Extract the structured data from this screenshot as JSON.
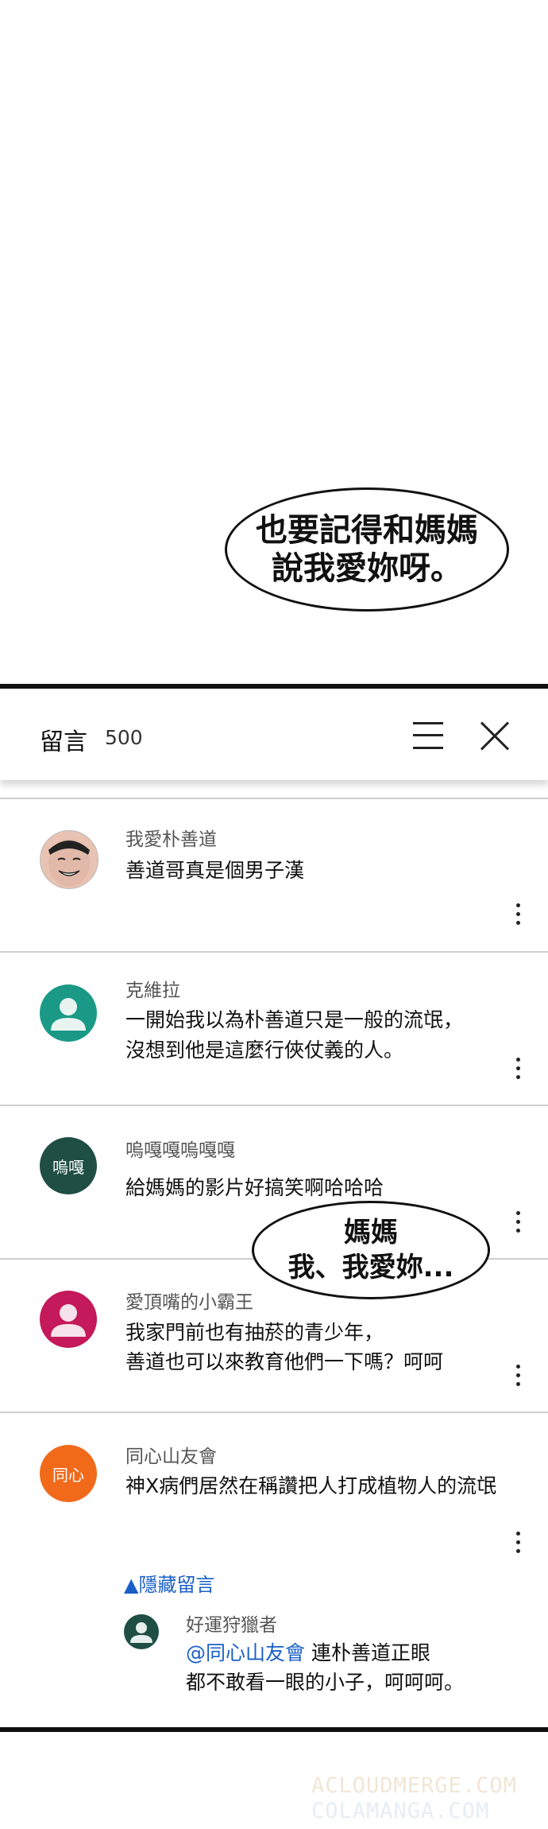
{
  "bubble_top": [
    "也要記得和媽媽",
    "說我愛妳呀。"
  ],
  "bubble_mid": [
    "媽媽",
    "我、我愛妳..."
  ],
  "comments_panel": {
    "title": "留言",
    "count": "500"
  },
  "comments": [
    {
      "author": "我愛朴善道",
      "lines": [
        "善道哥真是個男子漢"
      ],
      "avatar_text": ""
    },
    {
      "author": "克維拉",
      "lines": [
        "一開始我以為朴善道只是一般的流氓，",
        "沒想到他是這麼行俠仗義的人。"
      ],
      "avatar_text": "",
      "avatar_color": "#1a9a86"
    },
    {
      "author": "嗚嘎嘎嗚嘎嘎",
      "lines": [
        "給媽媽的影片好搞笑啊哈哈哈"
      ],
      "avatar_text": "嗚嘎",
      "avatar_color": "#1f4e44"
    },
    {
      "author": "愛頂嘴的小霸王",
      "lines": [
        "我家門前也有抽菸的青少年，",
        "善道也可以來教育他們一下嗎？呵呵"
      ],
      "avatar_text": "",
      "avatar_color": "#c4195a"
    },
    {
      "author": "同心山友會",
      "lines": [
        "神X病們居然在稱讚把人打成植物人的流氓"
      ],
      "avatar_text": "同心",
      "avatar_color": "#f06a1a"
    }
  ],
  "hide_replies_label": "▲隱藏留言",
  "reply": {
    "author": "好運狩獵者",
    "mention": "@同心山友會",
    "line1_rest": " 連朴善道正眼",
    "line2": "都不敢看一眼的小子，呵呵呵。",
    "avatar_color": "#1f4e44"
  },
  "watermarks": [
    "ACLOUDMERGE.COM",
    "COLAMANGA.COM"
  ]
}
